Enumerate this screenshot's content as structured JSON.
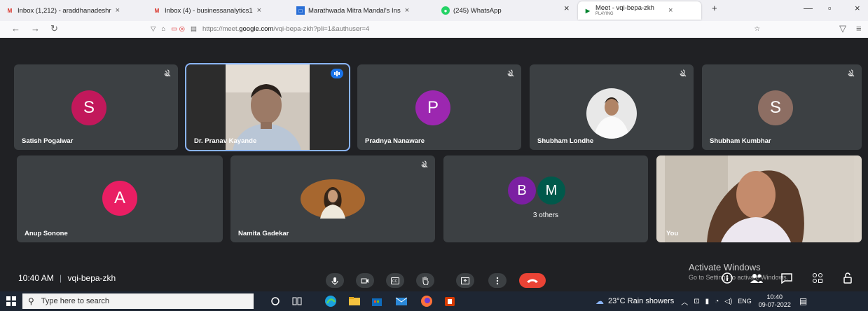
{
  "browser": {
    "tabs": [
      {
        "label": "Inbox (1,212) - araddhanadeshr",
        "icon": "gmail-icon"
      },
      {
        "label": "Inbox (4) - businessanalytics1",
        "icon": "gmail-icon"
      },
      {
        "label": "Marathwada Mitra Mandal's Ins",
        "icon": "site-icon"
      },
      {
        "label": "(245) WhatsApp",
        "icon": "whatsapp-icon"
      },
      {
        "label": "Meet - vqi-bepa-zkh",
        "sublabel": "PLAYING",
        "icon": "meet-icon",
        "active": true
      }
    ],
    "url_prefix": "https://meet.",
    "url_host": "google.com",
    "url_path": "/vqi-bepa-zkh?pli=1&authuser=4"
  },
  "meeting": {
    "time": "10:40 AM",
    "separator": "|",
    "code": "vqi-bepa-zkh",
    "row1": [
      {
        "name": "Satish Pogalwar",
        "initial": "S",
        "color": "#c2185b",
        "type": "avatar",
        "muted": true
      },
      {
        "name": "Dr. Pranav Kayande",
        "type": "video",
        "speaking": true
      },
      {
        "name": "Pradnya Nanaware",
        "initial": "P",
        "color": "#9c27b0",
        "type": "avatar",
        "muted": true
      },
      {
        "name": "Shubham Londhe",
        "type": "photo",
        "muted": true
      },
      {
        "name": "Shubham Kumbhar",
        "initial": "S",
        "color": "#8d6e63",
        "type": "avatar",
        "muted": true
      }
    ],
    "row2": [
      {
        "name": "Anup Sonone",
        "initial": "A",
        "color": "#e91e63",
        "type": "avatar"
      },
      {
        "name": "Namita Gadekar",
        "type": "photo",
        "muted": true
      },
      {
        "name": "3 others",
        "initials": [
          "B",
          "M"
        ],
        "colors": [
          "#7b1fa2",
          "#00594b"
        ],
        "type": "group"
      },
      {
        "name": "You",
        "type": "video"
      }
    ],
    "controls": [
      "mic-icon",
      "camera-icon",
      "captions-icon",
      "raise-hand-icon",
      "present-icon",
      "more-icon",
      "end-call-icon"
    ],
    "activate_title": "Activate Windows",
    "activate_sub": "Go to Settings to activate Windows."
  },
  "taskbar": {
    "search_placeholder": "Type here to search",
    "weather": "23°C  Rain showers",
    "lang": "ENG",
    "time": "10:40",
    "date": "09-07-2022"
  }
}
